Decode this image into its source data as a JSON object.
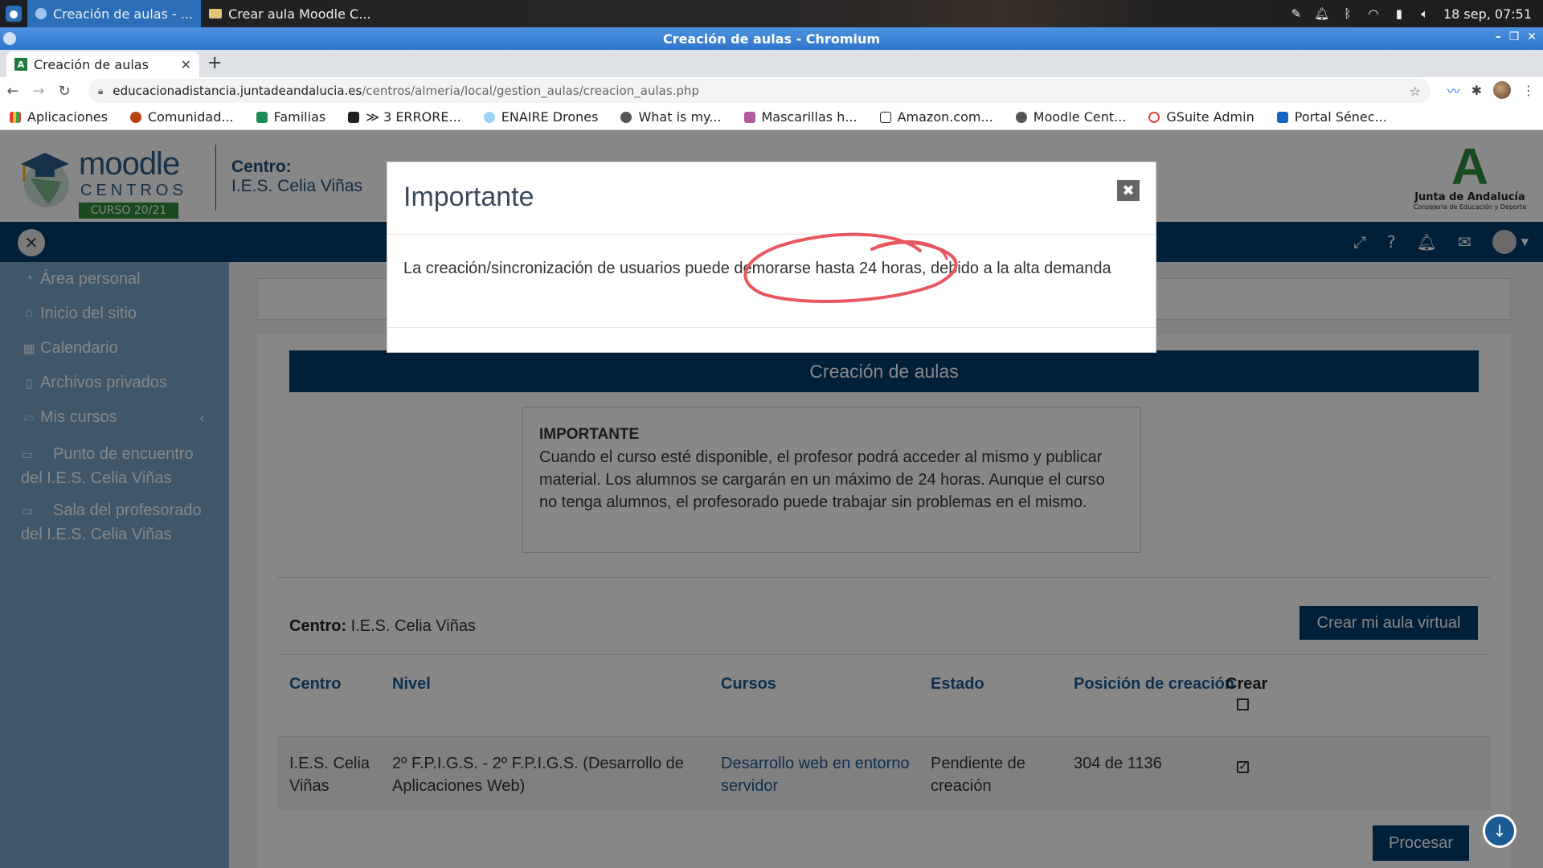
{
  "taskbar": {
    "tasks": [
      "Creación de aulas - ...",
      "Crear aula Moodle C..."
    ],
    "clock": "18 sep, 07:51"
  },
  "window": {
    "title": "Creación de aulas - Chromium"
  },
  "browser": {
    "tab_title": "Creación de aulas",
    "url_host": "educacionadistancia.juntadeandalucia.es",
    "url_path": "/centros/almeria/local/gestion_aulas/creacion_aulas.php",
    "bookmarks": [
      "Aplicaciones",
      "Comunidad...",
      "Familias",
      "≫ 3 ERRORE...",
      "ENAIRE Drones",
      "What is my...",
      "Mascarillas h...",
      "Amazon.com...",
      "Moodle Cent...",
      "GSuite Admin",
      "Portal Sénec..."
    ]
  },
  "header": {
    "logo_top": "moodle",
    "logo_mid": "CENTROS",
    "logo_badge": "CURSO 20/21",
    "centro_label": "Centro:",
    "centro_name": "I.E.S. Celia Viñas",
    "junta_line1": "Junta de Andalucía",
    "junta_line2": "Consejería de Educación y Deporte"
  },
  "sidebar": {
    "items": [
      {
        "label": "Área personal",
        "icon": "gauge-icon"
      },
      {
        "label": "Inicio del sitio",
        "icon": "home-icon"
      },
      {
        "label": "Calendario",
        "icon": "calendar-icon"
      },
      {
        "label": "Archivos privados",
        "icon": "file-icon"
      },
      {
        "label": "Mis cursos",
        "icon": "graduation-cap-icon"
      },
      {
        "label": "Punto de encuentro del I.E.S. Celia Viñas",
        "icon": "folder-icon"
      },
      {
        "label": "Sala del profesorado del I.E.S. Celia Viñas",
        "icon": "folder-icon"
      }
    ]
  },
  "main": {
    "banner": "Creación de aulas",
    "info_title": "IMPORTANTE",
    "info_text": "Cuando el curso esté disponible, el profesor podrá acceder al mismo y publicar material. Los alumnos se cargarán en un máximo de 24 horas. Aunque el curso no tenga alumnos, el profesorado puede trabajar sin problemas en el mismo.",
    "centro_label": "Centro:",
    "centro_value": "I.E.S. Celia Viñas",
    "create_button": "Crear mi aula virtual",
    "table": {
      "headers": [
        "Centro",
        "Nivel",
        "Cursos",
        "Estado",
        "Posición de creación",
        "Crear"
      ],
      "row": {
        "centro": "I.E.S. Celia Viñas",
        "nivel": "2º F.P.I.G.S. - 2º F.P.I.G.S. (Desarrollo de Aplicaciones Web)",
        "curso": "Desarrollo web en entorno servidor",
        "estado": "Pendiente de creación",
        "posicion": "304 de 1136",
        "crear_checked": true
      }
    },
    "process_button": "Procesar"
  },
  "modal": {
    "title": "Importante",
    "body": "La creación/sincronización de usuarios puede demorarse hasta 24 horas, debido a la alta demanda"
  },
  "colors": {
    "primary": "#003c6b",
    "link": "#1c5b93",
    "sidebar": "#7aa4c6",
    "annotation": "#e8575f"
  }
}
